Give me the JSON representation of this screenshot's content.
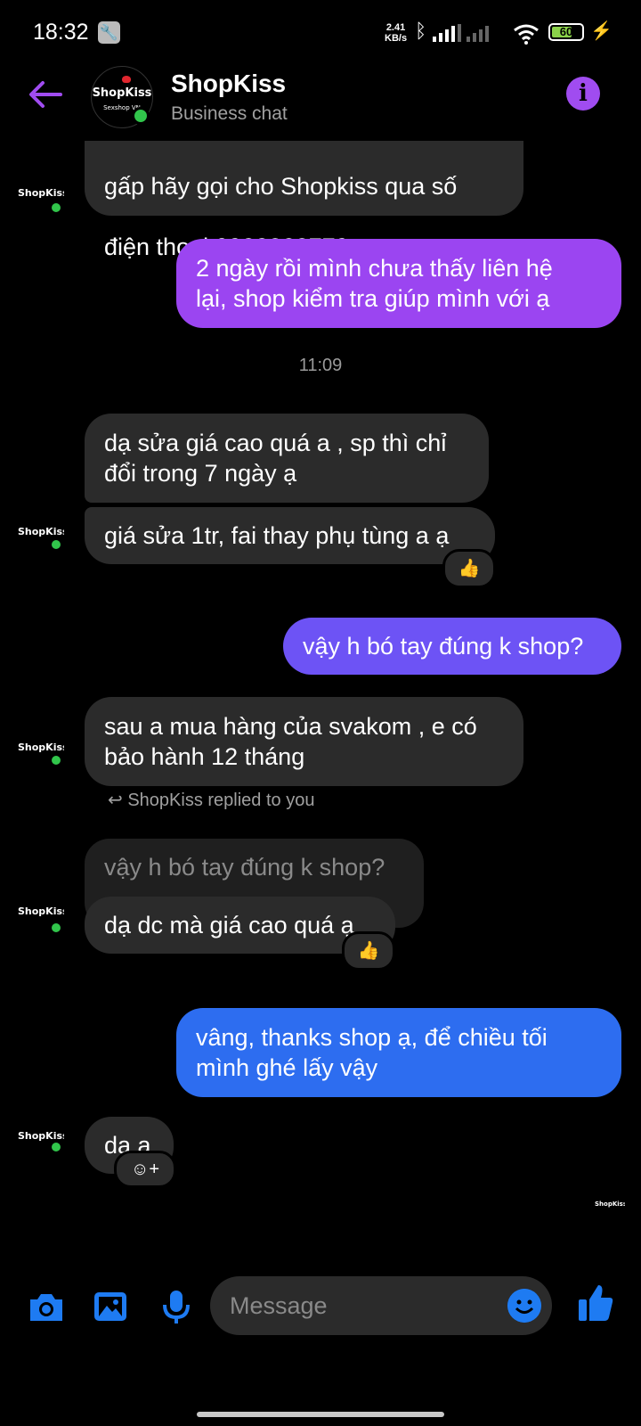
{
  "status_bar": {
    "time": "18:32",
    "net_speed_value": "2.41",
    "net_speed_unit": "KB/s",
    "battery": "60"
  },
  "header": {
    "title": "ShopKiss",
    "subtitle": "Business chat",
    "logo_text": "ShopKiss",
    "logo_sub": "Sexshop VN"
  },
  "messages": {
    "m1_line": "gấp hãy gọi cho Shopkiss qua số",
    "m1_prefix": "điện thoại ",
    "m1_phone": "0933828779",
    "m2": "2 ngày rồi mình chưa thấy liên hệ\nlại, shop kiểm tra giúp mình với ạ",
    "timestamp": "11:09",
    "m3": "dạ sửa giá cao quá a , sp thì chỉ\nđổi trong 7 ngày ạ",
    "m4": "giá sửa 1tr, fai thay phụ tùng a ạ",
    "m5": "vậy h bó tay đúng k shop?",
    "m6": "sau a mua hàng của svakom , e có\nbảo hành 12 tháng",
    "replied_label": "ShopKiss replied to you",
    "quoted": "vậy h bó tay đúng k shop?",
    "m7": "dạ dc mà giá cao quá ạ",
    "m8": "vâng, thanks shop ạ, để chiều tối\nmình ghé lấy vậy",
    "m9": "dạ a",
    "reaction": "👍"
  },
  "composer": {
    "placeholder": "Message"
  },
  "colors": {
    "accent_purple": "#9b45f1",
    "bubble_violet": "#6d53f5",
    "bubble_blue": "#2d6df0",
    "icon_blue": "#1e7bf2",
    "incoming": "#2b2b2b"
  }
}
